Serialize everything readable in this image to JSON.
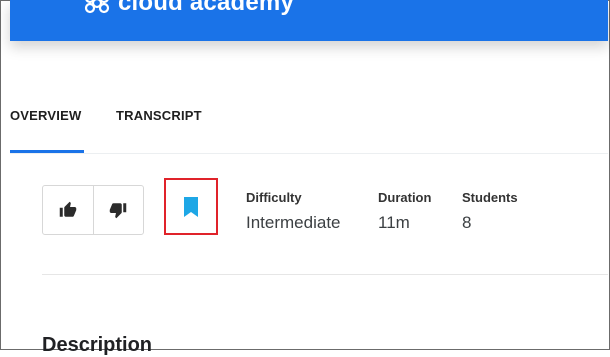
{
  "brand": {
    "name": "cloud academy"
  },
  "tabs": [
    {
      "label": "OVERVIEW",
      "active": true
    },
    {
      "label": "TRANSCRIPT",
      "active": false
    }
  ],
  "stats": [
    {
      "label": "Difficulty",
      "value": "Intermediate"
    },
    {
      "label": "Duration",
      "value": "11m"
    },
    {
      "label": "Students",
      "value": "8"
    }
  ],
  "sections": {
    "description_heading": "Description"
  },
  "icons": {
    "logo": "cloud-academy-logo-icon",
    "like": "thumbs-up-icon",
    "dislike": "thumbs-down-icon",
    "bookmark": "bookmark-icon"
  },
  "colors": {
    "brand_blue": "#1a73e8",
    "bookmark_blue": "#1ea7e6",
    "highlight_red": "#e0232a"
  }
}
